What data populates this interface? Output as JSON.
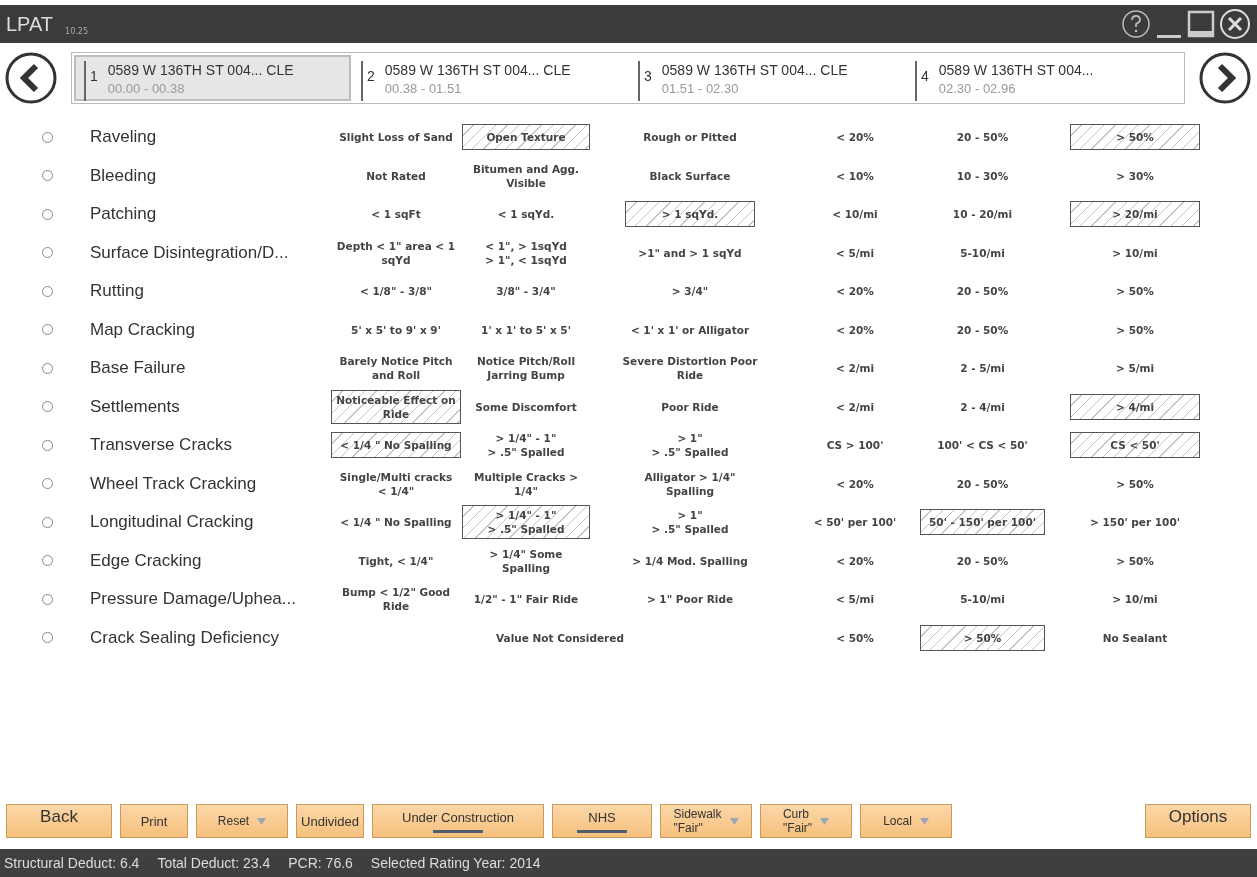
{
  "window": {
    "title": "LPAT",
    "version": "10.25"
  },
  "segments": [
    {
      "number": "1",
      "name": "0589 W 136TH ST 004... CLE",
      "range": "00.00 - 00.38",
      "selected": true
    },
    {
      "number": "2",
      "name": "0589 W 136TH ST 004... CLE",
      "range": "00.38 - 01.51",
      "selected": false
    },
    {
      "number": "3",
      "name": "0589 W 136TH ST 004... CLE",
      "range": "01.51 - 02.30",
      "selected": false
    },
    {
      "number": "4",
      "name": "0589 W 136TH ST 004...",
      "range": "02.30 - 02.96",
      "selected": false
    }
  ],
  "distresses": [
    {
      "name": "Raveling",
      "selected": false,
      "cells": [
        {
          "text": "Slight Loss of Sand",
          "selected": false
        },
        {
          "text": "Open Texture",
          "selected": true
        },
        {
          "text": "Rough or Pitted",
          "selected": false
        },
        {
          "text": "< 20%",
          "selected": false
        },
        {
          "text": "20 - 50%",
          "selected": false
        },
        {
          "text": "> 50%",
          "selected": true
        }
      ]
    },
    {
      "name": "Bleeding",
      "selected": false,
      "cells": [
        {
          "text": "Not Rated",
          "selected": false
        },
        {
          "text": "Bitumen and Agg. Visible",
          "selected": false
        },
        {
          "text": "Black Surface",
          "selected": false
        },
        {
          "text": "< 10%",
          "selected": false
        },
        {
          "text": "10 - 30%",
          "selected": false
        },
        {
          "text": "> 30%",
          "selected": false
        }
      ]
    },
    {
      "name": "Patching",
      "selected": false,
      "cells": [
        {
          "text": "< 1 sqFt",
          "selected": false
        },
        {
          "text": "< 1 sqYd.",
          "selected": false
        },
        {
          "text": "> 1 sqYd.",
          "selected": true
        },
        {
          "text": "< 10/mi",
          "selected": false
        },
        {
          "text": "10 - 20/mi",
          "selected": false
        },
        {
          "text": "> 20/mi",
          "selected": true
        }
      ]
    },
    {
      "name": "Surface Disintegration/D...",
      "selected": false,
      "cells": [
        {
          "text": "Depth < 1\" area < 1 sqYd",
          "selected": false
        },
        {
          "text": "< 1\", > 1sqYd\n> 1\", < 1sqYd",
          "selected": false
        },
        {
          "text": ">1\" and > 1 sqYd",
          "selected": false
        },
        {
          "text": "< 5/mi",
          "selected": false
        },
        {
          "text": "5-10/mi",
          "selected": false
        },
        {
          "text": "> 10/mi",
          "selected": false
        }
      ]
    },
    {
      "name": "Rutting",
      "selected": false,
      "cells": [
        {
          "text": "< 1/8\" - 3/8\"",
          "selected": false
        },
        {
          "text": "3/8\" - 3/4\"",
          "selected": false
        },
        {
          "text": "> 3/4\"",
          "selected": false
        },
        {
          "text": "< 20%",
          "selected": false
        },
        {
          "text": "20 - 50%",
          "selected": false
        },
        {
          "text": "> 50%",
          "selected": false
        }
      ]
    },
    {
      "name": "Map Cracking",
      "selected": false,
      "cells": [
        {
          "text": "5' x 5' to 9' x 9'",
          "selected": false
        },
        {
          "text": "1' x 1' to 5' x 5'",
          "selected": false
        },
        {
          "text": "< 1' x 1' or Alligator",
          "selected": false
        },
        {
          "text": "< 20%",
          "selected": false
        },
        {
          "text": "20 - 50%",
          "selected": false
        },
        {
          "text": "> 50%",
          "selected": false
        }
      ]
    },
    {
      "name": "Base Failure",
      "selected": false,
      "cells": [
        {
          "text": "Barely Notice Pitch and Roll",
          "selected": false
        },
        {
          "text": "Notice Pitch/Roll Jarring Bump",
          "selected": false
        },
        {
          "text": "Severe Distortion Poor Ride",
          "selected": false
        },
        {
          "text": "< 2/mi",
          "selected": false
        },
        {
          "text": "2 - 5/mi",
          "selected": false
        },
        {
          "text": "> 5/mi",
          "selected": false
        }
      ]
    },
    {
      "name": "Settlements",
      "selected": false,
      "cells": [
        {
          "text": "Noticeable Effect on Ride",
          "selected": true
        },
        {
          "text": "Some Discomfort",
          "selected": false
        },
        {
          "text": "Poor Ride",
          "selected": false
        },
        {
          "text": "< 2/mi",
          "selected": false
        },
        {
          "text": "2 - 4/mi",
          "selected": false
        },
        {
          "text": "> 4/mi",
          "selected": true
        }
      ]
    },
    {
      "name": "Transverse Cracks",
      "selected": false,
      "cells": [
        {
          "text": "< 1/4 \" No Spalling",
          "selected": true
        },
        {
          "text": "> 1/4\" - 1\"\n> .5\" Spalled",
          "selected": false
        },
        {
          "text": "> 1\"\n> .5\" Spalled",
          "selected": false
        },
        {
          "text": "CS > 100'",
          "selected": false
        },
        {
          "text": "100' < CS < 50'",
          "selected": false
        },
        {
          "text": "CS < 50'",
          "selected": true
        }
      ]
    },
    {
      "name": "Wheel Track Cracking",
      "selected": false,
      "cells": [
        {
          "text": "Single/Multi cracks < 1/4\"",
          "selected": false
        },
        {
          "text": "Multiple Cracks > 1/4\"",
          "selected": false
        },
        {
          "text": "Alligator > 1/4\" Spalling",
          "selected": false
        },
        {
          "text": "< 20%",
          "selected": false
        },
        {
          "text": "20 - 50%",
          "selected": false
        },
        {
          "text": "> 50%",
          "selected": false
        }
      ]
    },
    {
      "name": "Longitudinal Cracking",
      "selected": false,
      "cells": [
        {
          "text": "< 1/4 \" No Spalling",
          "selected": false
        },
        {
          "text": "> 1/4\" - 1\"\n> .5\" Spalled",
          "selected": true
        },
        {
          "text": "> 1\"\n> .5\" Spalled",
          "selected": false
        },
        {
          "text": "< 50' per 100'",
          "selected": false
        },
        {
          "text": "50' - 150' per 100'",
          "selected": true
        },
        {
          "text": "> 150' per 100'",
          "selected": false
        }
      ]
    },
    {
      "name": "Edge Cracking",
      "selected": false,
      "cells": [
        {
          "text": "Tight, < 1/4\"",
          "selected": false
        },
        {
          "text": "> 1/4\" Some Spalling",
          "selected": false
        },
        {
          "text": "> 1/4 Mod. Spalling",
          "selected": false
        },
        {
          "text": "< 20%",
          "selected": false
        },
        {
          "text": "20 - 50%",
          "selected": false
        },
        {
          "text": "> 50%",
          "selected": false
        }
      ]
    },
    {
      "name": "Pressure Damage/Uphea...",
      "selected": false,
      "cells": [
        {
          "text": "Bump < 1/2\" Good Ride",
          "selected": false
        },
        {
          "text": "1/2\" - 1\" Fair Ride",
          "selected": false
        },
        {
          "text": "> 1\" Poor Ride",
          "selected": false
        },
        {
          "text": "< 5/mi",
          "selected": false
        },
        {
          "text": "5-10/mi",
          "selected": false
        },
        {
          "text": "> 10/mi",
          "selected": false
        }
      ]
    },
    {
      "name": "Crack Sealing Deficiency",
      "selected": false,
      "cells": [
        {
          "text": "Value Not Considered",
          "selected": false,
          "kind": "wide"
        },
        {
          "text": "< 50%",
          "selected": false
        },
        {
          "text": "> 50%",
          "selected": true
        },
        {
          "text": "No Sealant",
          "selected": false
        }
      ]
    }
  ],
  "toolbar": [
    {
      "kind": "large",
      "label": "Back"
    },
    {
      "kind": "button",
      "label": "Print"
    },
    {
      "kind": "dropdown",
      "label": "Reset"
    },
    {
      "kind": "button",
      "label": "Undivided"
    },
    {
      "kind": "toggle",
      "label": "Under Construction",
      "on": true
    },
    {
      "kind": "toggle",
      "label": "NHS",
      "on": true
    },
    {
      "kind": "dropdown",
      "label": "Sidewalk",
      "value": "\"Fair\""
    },
    {
      "kind": "dropdown",
      "label": "Curb",
      "value": "\"Fair\""
    },
    {
      "kind": "dropdown",
      "label": "Local"
    },
    {
      "kind": "large",
      "label": "Options"
    }
  ],
  "status_bar": [
    "Structural Deduct: 6.4",
    "Total Deduct: 23.4",
    "PCR: 76.6",
    "Selected Rating Year: 2014"
  ]
}
